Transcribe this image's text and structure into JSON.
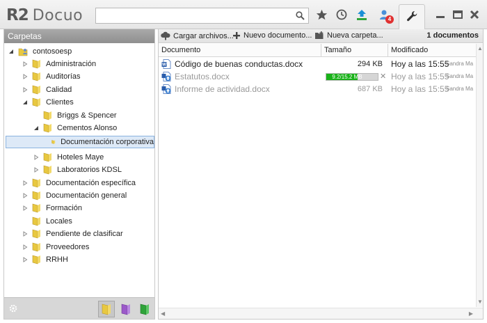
{
  "app": {
    "logo_mark": "R2",
    "logo_text": "Docuo",
    "search_placeholder": "",
    "notification_count": "4"
  },
  "icons": {
    "toolbar": [
      "search-icon",
      "star-icon",
      "clock-icon",
      "upload-icon",
      "users-icon",
      "wrench-icon",
      "minimize-icon",
      "maximize-icon",
      "close-icon"
    ]
  },
  "sidebar": {
    "header": "Carpetas",
    "root": "contosoesp",
    "items": [
      {
        "label": "Administración",
        "level": 1,
        "expander": "collapsed"
      },
      {
        "label": "Auditorías",
        "level": 1,
        "expander": "collapsed"
      },
      {
        "label": "Calidad",
        "level": 1,
        "expander": "collapsed"
      },
      {
        "label": "Clientes",
        "level": 1,
        "expander": "expanded"
      },
      {
        "label": "Briggs & Spencer",
        "level": 2,
        "expander": "none"
      },
      {
        "label": "Cementos Alonso",
        "level": 2,
        "expander": "expanded"
      },
      {
        "label": "Documentación corporativa",
        "level": 3,
        "expander": "none",
        "selected": true
      },
      {
        "label": "Hoteles Maye",
        "level": 2,
        "expander": "collapsed"
      },
      {
        "label": "Laboratorios KDSL",
        "level": 2,
        "expander": "collapsed"
      },
      {
        "label": "Documentación específica",
        "level": 1,
        "expander": "collapsed"
      },
      {
        "label": "Documentación general",
        "level": 1,
        "expander": "collapsed"
      },
      {
        "label": "Formación",
        "level": 1,
        "expander": "collapsed"
      },
      {
        "label": "Locales",
        "level": 1,
        "expander": "none"
      },
      {
        "label": "Pendiente de clasificar",
        "level": 1,
        "expander": "collapsed"
      },
      {
        "label": "Proveedores",
        "level": 1,
        "expander": "collapsed"
      },
      {
        "label": "RRHH",
        "level": 1,
        "expander": "collapsed"
      }
    ],
    "footer_colors": [
      "#e8c840",
      "#9b59c9",
      "#2fa33a"
    ]
  },
  "toolbar": {
    "upload_label": "Cargar archivos...",
    "new_doc_label": "Nuevo documento...",
    "new_folder_label": "Nueva carpeta...",
    "doc_count": "1 documentos"
  },
  "table": {
    "columns": [
      "Documento",
      "Tamaño",
      "Modificado"
    ],
    "rows": [
      {
        "name": "Código de buenas conductas.docx",
        "size": "294 KB",
        "modified": "Hoy a las 15:55",
        "user": "Sandra Ma",
        "state": "done"
      },
      {
        "name": "Estatutos.docx",
        "size": "",
        "progress_text": "9.2/15.2 MB",
        "progress": 0.605,
        "modified": "Hoy a las 15:55",
        "user": "Sandra Ma",
        "state": "uploading"
      },
      {
        "name": "Informe de actividad.docx",
        "size": "687 KB",
        "modified": "Hoy a las 15:55",
        "user": "Sandra Ma",
        "state": "pending"
      }
    ]
  },
  "colors": {
    "folder": "#e8c840",
    "header_gray": "#9c9c9c",
    "selection": "#dde9f7",
    "progress": "#19b219",
    "badge": "#e03030"
  }
}
